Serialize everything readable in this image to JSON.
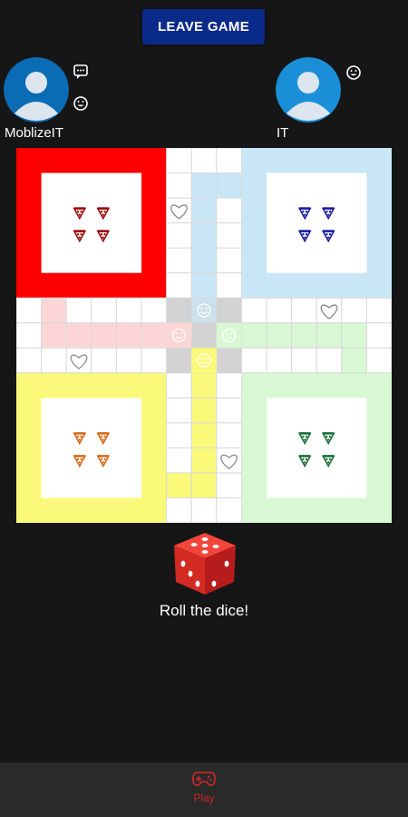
{
  "header": {
    "leave_label": "LEAVE GAME"
  },
  "players": [
    {
      "name": "MoblizeIT",
      "avatar_color": "#0a6cb5"
    },
    {
      "name": "IT",
      "avatar_color": "#1a8fd8"
    }
  ],
  "board": {
    "colors": {
      "red": "#ff0000",
      "blue": "#c9e6f6",
      "yellow": "#fbf97a",
      "green": "#d8f8d4"
    },
    "token_icon": "pizza-slice-icon",
    "safe_icon": "heart-icon",
    "star_icon": "smiley-icon"
  },
  "dice": {
    "value": 5,
    "prompt": "Roll the dice!"
  },
  "nav": {
    "play_label": "Play",
    "accent": "#c62828"
  }
}
